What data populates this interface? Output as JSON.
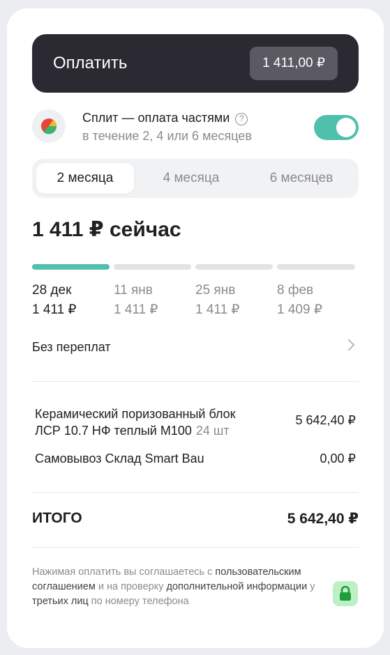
{
  "pay_button": {
    "label": "Оплатить",
    "amount": "1 411,00 ₽"
  },
  "split": {
    "title": "Сплит — оплата частями",
    "help_icon": "?",
    "subtitle": "в течение 2, 4 или 6 месяцев",
    "enabled": true,
    "accent_color": "#50bfab"
  },
  "tabs": [
    {
      "label": "2 месяца",
      "active": true
    },
    {
      "label": "4 месяца",
      "active": false
    },
    {
      "label": "6 месяцев",
      "active": false
    }
  ],
  "now": "1 411 ₽ сейчас",
  "schedule": [
    {
      "date": "28 дек",
      "amount": "1 411 ₽",
      "paid": true
    },
    {
      "date": "11 янв",
      "amount": "1 411 ₽",
      "paid": false
    },
    {
      "date": "25 янв",
      "amount": "1 411 ₽",
      "paid": false
    },
    {
      "date": "8 фев",
      "amount": "1 409 ₽",
      "paid": false
    }
  ],
  "overpayment": {
    "label": "Без переплат"
  },
  "order": {
    "item": {
      "name_line1": "Керамический поризованный блок",
      "name_line2": "ЛСР 10.7 НФ теплый М100",
      "qty": "24 шт",
      "price": "5 642,40 ₽"
    },
    "delivery": {
      "name": "Самовывоз Склад Smart Bau",
      "price": "0,00 ₽"
    }
  },
  "total": {
    "label": "ИТОГО",
    "value": "5 642,40 ₽"
  },
  "legal": {
    "part1": "Нажимая оплатить вы соглашаетесь с ",
    "link1": "пользовательским соглашением",
    "part2": " и на проверку ",
    "link2": "дополнительной информации",
    "part3": " у ",
    "link3": "третьих лиц",
    "part4": " по номеру телефона"
  },
  "icons": {
    "lock": "lock-icon",
    "split_logo": "split-logo-icon",
    "chevron": "chevron-right-icon"
  }
}
